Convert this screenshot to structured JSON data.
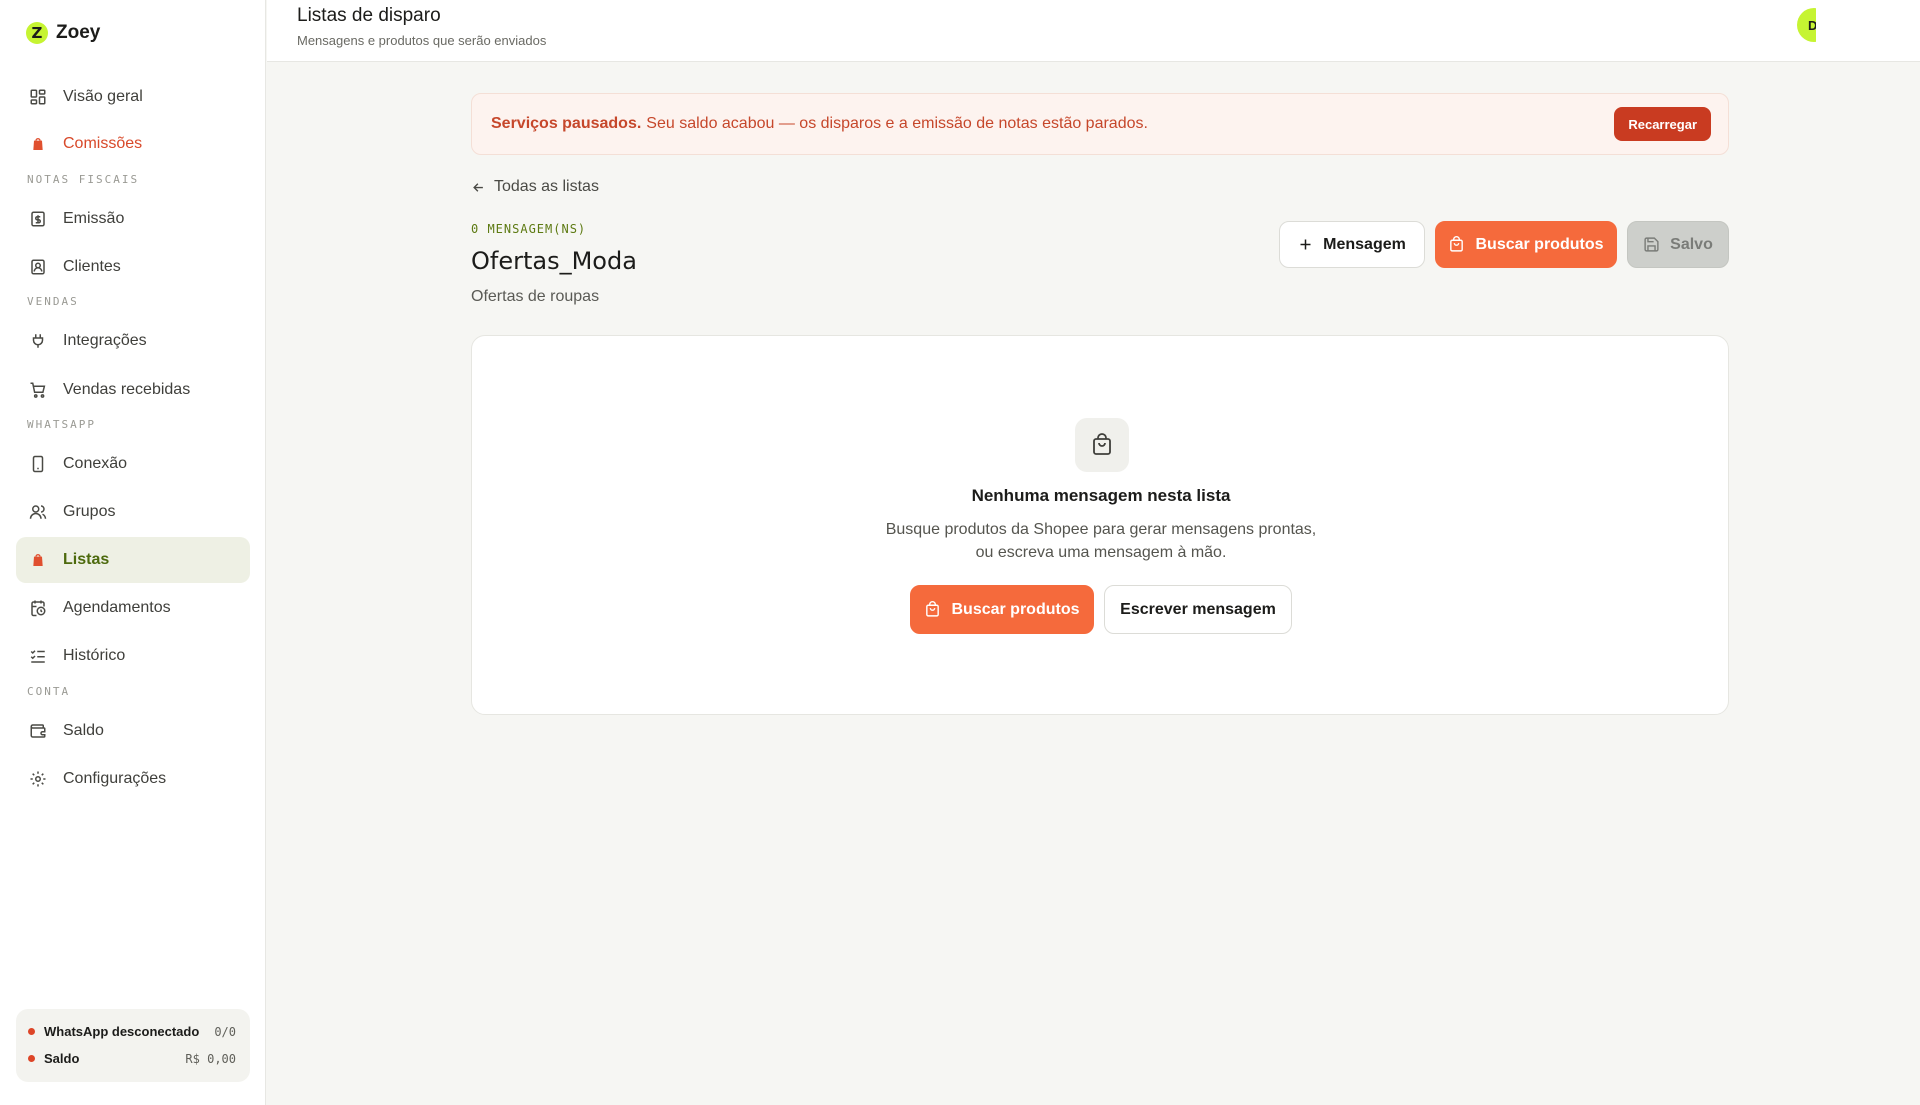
{
  "app": {
    "name": "Zoey",
    "logo_letter": "Z"
  },
  "sidebar": {
    "items": [
      {
        "label": "Visão geral",
        "icon": "dashboard-icon"
      },
      {
        "label": "Comissões",
        "icon": "bag-icon"
      },
      {
        "label": "Emissão",
        "icon": "receipt-icon"
      },
      {
        "label": "Clientes",
        "icon": "contact-icon"
      },
      {
        "label": "Integrações",
        "icon": "plug-icon"
      },
      {
        "label": "Vendas recebidas",
        "icon": "cart-icon"
      },
      {
        "label": "Conexão",
        "icon": "phone-icon"
      },
      {
        "label": "Grupos",
        "icon": "users-icon"
      },
      {
        "label": "Listas",
        "icon": "bag-icon"
      },
      {
        "label": "Agendamentos",
        "icon": "calendar-clock-icon"
      },
      {
        "label": "Histórico",
        "icon": "list-check-icon"
      },
      {
        "label": "Saldo",
        "icon": "wallet-icon"
      },
      {
        "label": "Configurações",
        "icon": "gear-icon"
      }
    ],
    "sections": {
      "notas_fiscais": "NOTAS FISCAIS",
      "vendas": "VENDAS",
      "whatsapp": "WHATSAPP",
      "conta": "CONTA"
    },
    "status": {
      "whatsapp_label": "WhatsApp desconectado",
      "whatsapp_value": "0/0",
      "saldo_label": "Saldo",
      "saldo_value": "R$ 0,00"
    }
  },
  "header": {
    "title": "Listas de disparo",
    "subtitle": "Mensagens e produtos que serão enviados",
    "avatar_initial": "D"
  },
  "alert": {
    "strong": "Serviços pausados.",
    "text": "Seu saldo acabou — os disparos e a emissão de notas estão parados.",
    "button": "Recarregar"
  },
  "list": {
    "back": "Todas as listas",
    "count": "0 MENSAGEM(NS)",
    "name": "Ofertas_Moda",
    "description": "Ofertas de roupas",
    "actions": {
      "add_message": "Mensagem",
      "search_products": "Buscar produtos",
      "saved": "Salvo"
    }
  },
  "empty": {
    "title": "Nenhuma mensagem nesta lista",
    "line1": "Busque produtos da Shopee para gerar mensagens prontas,",
    "line2": "ou escreva uma mensagem à mão.",
    "primary": "Buscar produtos",
    "secondary": "Escrever mensagem"
  },
  "colors": {
    "accent": "#f56a3c",
    "brand": "#c6f432",
    "danger": "#c93b21",
    "active_bg": "#eef0e4"
  }
}
